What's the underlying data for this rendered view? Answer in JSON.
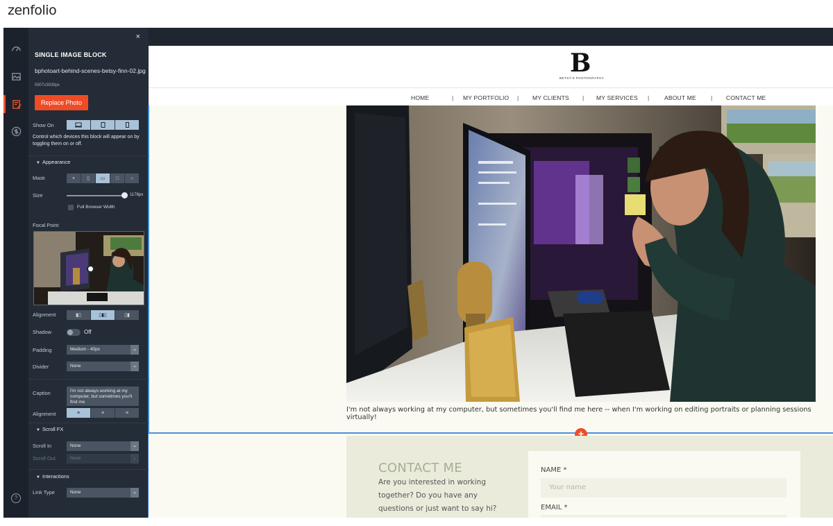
{
  "brand": "zenfolio",
  "rail": [
    "dashboard-icon",
    "image-library-icon",
    "edit-block-icon",
    "dollar-icon",
    "help-icon"
  ],
  "panel": {
    "close": "×",
    "title": "SINGLE IMAGE BLOCK",
    "file_name": "bphotoart-behind-scenes-betsy-finn-02.jpg",
    "file_size": "5907x3938px",
    "replace_button": "Replace Photo",
    "show_on_label": "Show On",
    "show_on_help": "Control which devices this block will appear on by toggling them on or off.",
    "appearance_head": "Appearance",
    "mask_label": "Mask",
    "mask_options": [
      "×",
      "▯",
      "▭",
      "□",
      "○"
    ],
    "size_label": "Size",
    "size_value": "1176px",
    "full_width_label": "Full Browser Width",
    "focal_label": "Focal Point",
    "alignment_label": "Alignment",
    "shadow_label": "Shadow",
    "shadow_value": "Off",
    "padding_label": "Padding",
    "padding_value": "Medium - 40px",
    "divider_label": "Divider",
    "divider_value": "None",
    "caption_label": "Caption",
    "caption_value": "I'm not always working at my computer, but sometimes you'll find me",
    "caption_alignment_label": "Alignment",
    "scroll_fx_head": "Scroll FX",
    "scroll_in_label": "Scroll In",
    "scroll_in_value": "None",
    "scroll_out_label": "Scroll Out",
    "scroll_out_value": "None",
    "interactions_head": "Interactions",
    "link_type_label": "Link Type",
    "link_type_value": "None",
    "help": "?"
  },
  "site": {
    "logo_letter": "B",
    "logo_sub": "BETSY'S PHOTOGRAPHY",
    "nav": [
      "HOME",
      "MY PORTFOLIO",
      "MY CLIENTS",
      "MY SERVICES",
      "ABOUT ME",
      "CONTACT ME"
    ],
    "nav_sep": "|",
    "caption": "I'm not always working at my computer, but sometimes you'll find me here -- when I'm working on editing portraits or planning sessions virtually!",
    "add": "+",
    "contact_title": "CONTACT ME",
    "contact_body": "Are you interested in working together? Do you have any questions or just want to say hi? Drop me a line by filling out this form and I will",
    "name_label": "NAME *",
    "name_placeholder": "Your name",
    "email_label": "EMAIL *"
  },
  "colors": {
    "accent": "#ef4b26",
    "panel_bg": "#242c37",
    "selection_blue": "#4a90d9",
    "contact_bg": "#eaebdb"
  }
}
